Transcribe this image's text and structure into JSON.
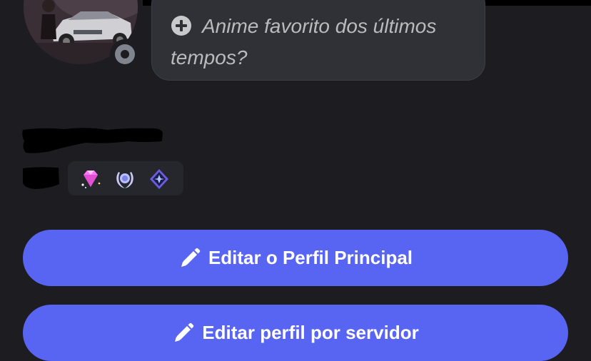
{
  "profile": {
    "avatar_icon": "user-avatar-car-photo",
    "status": "offline",
    "status_icon": "offline-status-icon"
  },
  "note": {
    "icon": "plus-circle-icon",
    "placeholder": "Anime favorito dos últimos tempos?"
  },
  "badges": [
    {
      "icon": "nitro-gem-icon"
    },
    {
      "icon": "laurel-badge-icon"
    },
    {
      "icon": "hypesquad-star-icon"
    }
  ],
  "actions": {
    "edit_main_profile": "Editar o Perfil Principal",
    "edit_server_profile": "Editar perfil por servidor"
  },
  "colors": {
    "background": "#1d1d21",
    "bubble": "#303136",
    "accent": "#5865f2",
    "status_offline": "#7f848e"
  }
}
